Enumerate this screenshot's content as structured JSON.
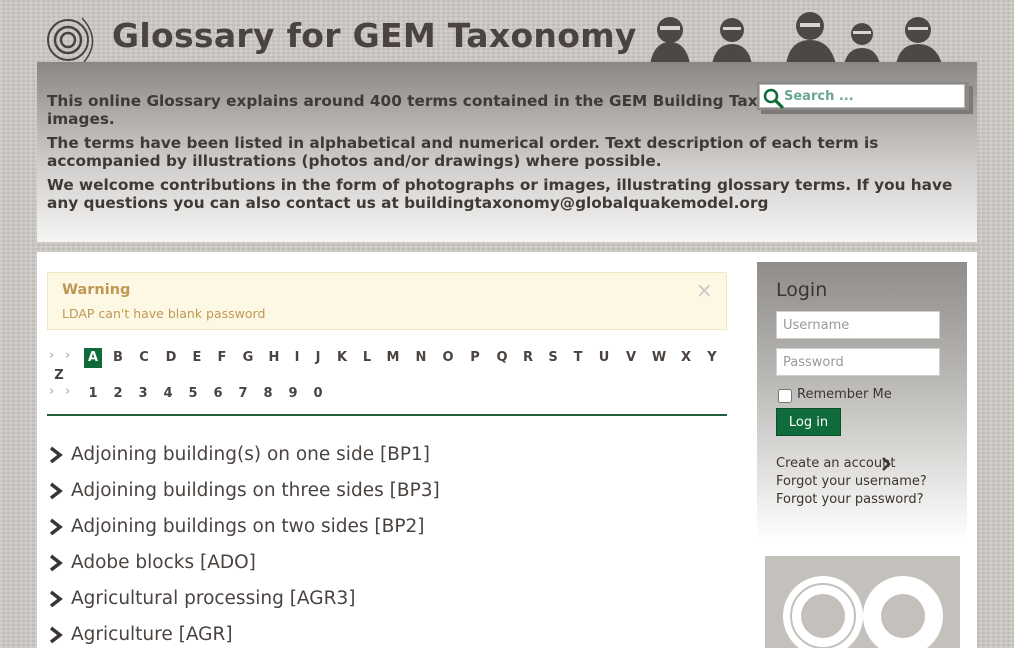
{
  "header": {
    "title": "Glossary for GEM Taxonomy",
    "intro": [
      "This online Glossary explains around 400 terms contained in the GEM Building Taxonomy and nearly 700 images.",
      "The terms have been listed in alphabetical and numerical order. Text description of each term is accompanied by illustrations (photos and/or drawings) where possible.",
      "We welcome contributions in the form of photographs or images, illustrating glossary terms. If you have any questions you can also contact us at buildingtaxonomy@globalquakemodel.org"
    ]
  },
  "search": {
    "placeholder": "Search ..."
  },
  "alert": {
    "title": "Warning",
    "message": "LDAP can't have blank password",
    "close": "×"
  },
  "alphabet": {
    "active": "A",
    "letters": [
      "A",
      "B",
      "C",
      "D",
      "E",
      "F",
      "G",
      "H",
      "I",
      "J",
      "K",
      "L",
      "M",
      "N",
      "O",
      "P",
      "Q",
      "R",
      "S",
      "T",
      "U",
      "V",
      "W",
      "X",
      "Y",
      "Z"
    ],
    "numbers": [
      "1",
      "2",
      "3",
      "4",
      "5",
      "6",
      "7",
      "8",
      "9",
      "0"
    ]
  },
  "terms": [
    "Adjoining building(s) on one side [BP1]",
    "Adjoining buildings on three sides [BP3]",
    "Adjoining buildings on two sides [BP2]",
    "Adobe blocks [ADO]",
    "Agricultural processing [AGR3]",
    "Agriculture [AGR]"
  ],
  "login": {
    "heading": "Login",
    "username_placeholder": "Username",
    "password_placeholder": "Password",
    "remember_label": "Remember Me",
    "button": "Log in",
    "create_account": "Create an account",
    "forgot_username": "Forgot your username?",
    "forgot_password": "Forgot your password?"
  },
  "colors": {
    "accent": "#0f6b3a",
    "warning_text": "#c09853",
    "warning_bg": "#fcf8e3",
    "text": "#4a4340"
  }
}
